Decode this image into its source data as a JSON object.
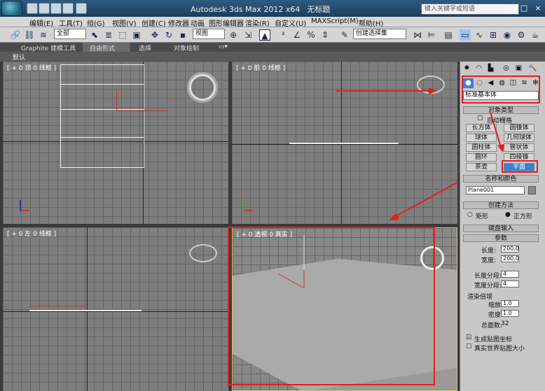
{
  "window": {
    "title": "Autodesk 3ds Max  2012 x64",
    "doc": "无标题",
    "search_placeholder": "键入关键字或短语"
  },
  "menu": [
    "编辑(E)",
    "工具(T)",
    "组(G)",
    "视图(V)",
    "创建(C)",
    "修改器",
    "动画",
    "图形编辑器",
    "渲染(R)",
    "自定义(U)",
    "MAXScript(M)",
    "帮助(H)"
  ],
  "toolbar": {
    "filter": "全部",
    "refcoord": "视图",
    "selset": "创建选择集"
  },
  "ribbon": {
    "tabs": [
      "Graphite 建模工具",
      "自由形式",
      "选择",
      "对象绘制"
    ],
    "active": "自由形式",
    "default": "默认"
  },
  "viewports": {
    "top": "[ + 0 顶 0 线框 ]",
    "front": "[ + 0 前 0 线框 ]",
    "left": "[ + 0 左 0 线框 ]",
    "persp": "[ + 0 透视 0 真实 ]"
  },
  "panel": {
    "category": "标准基本体",
    "object_type": "对象类型",
    "auto_grid": "自动栅格",
    "buttons": [
      "长方体",
      "圆锥体",
      "球体",
      "几何球体",
      "圆柱体",
      "管状体",
      "圆环",
      "四棱锥",
      "茶壶",
      "平面"
    ],
    "active_button": "平面",
    "name_color": "名称和颜色",
    "name": "Plane001",
    "creation_method": "创建方法",
    "methods": [
      "矩形",
      "正方形"
    ],
    "selected_method": "正方形",
    "keyboard": "键盘输入",
    "params": "参数",
    "length_lbl": "长度:",
    "length": "200.0",
    "width_lbl": "宽度:",
    "width": "200.0",
    "lseg_lbl": "长度分段:",
    "lseg": "4",
    "wseg_lbl": "宽度分段:",
    "wseg": "4",
    "render_mult": "渲染倍增",
    "scale_lbl": "缩放:",
    "scale": "1.0",
    "density_lbl": "密度:",
    "density": "1.0",
    "faces_lbl": "总面数:",
    "faces": "32",
    "gen_map": "生成贴图坐标",
    "real_world": "真实世界贴图大小"
  },
  "colors": {
    "annotation": "#e02020",
    "active_btn": "#3a7fd0"
  }
}
